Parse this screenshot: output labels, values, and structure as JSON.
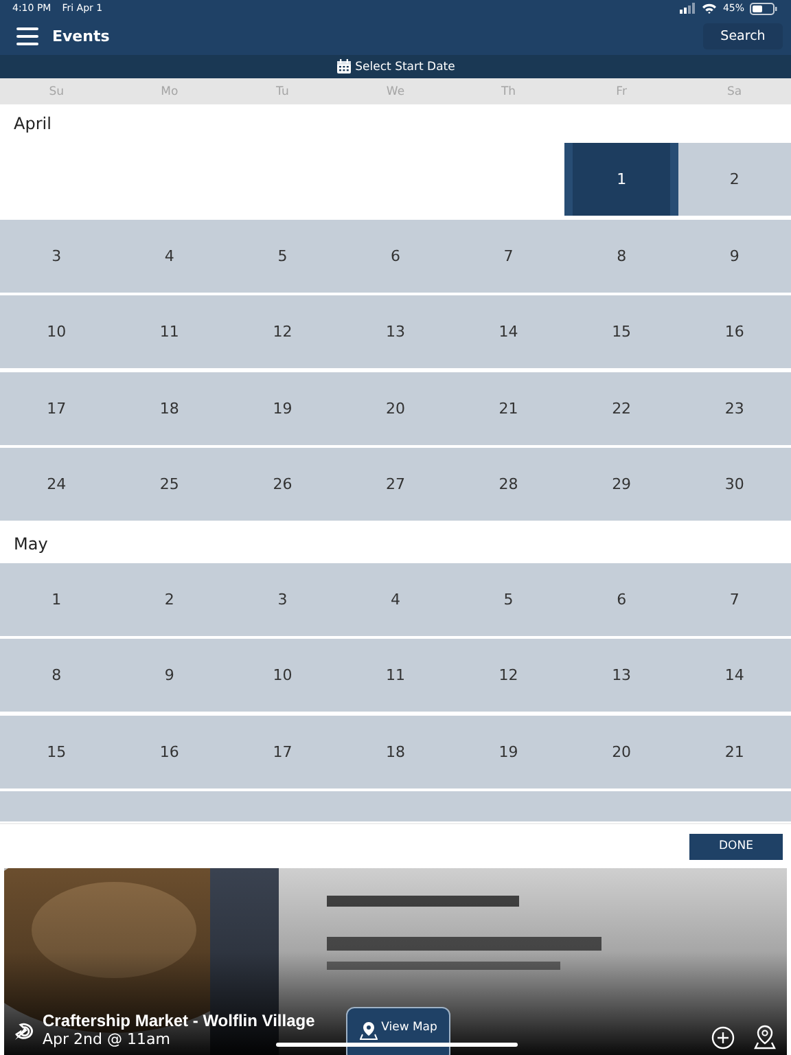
{
  "status_bar": {
    "time": "4:10 PM",
    "date": "Fri Apr 1",
    "battery": "45%"
  },
  "header": {
    "title": "Events",
    "search_button": "Search"
  },
  "date_bar": {
    "label": "Select Start Date"
  },
  "weekdays": [
    "Su",
    "Mo",
    "Tu",
    "We",
    "Th",
    "Fr",
    "Sa"
  ],
  "months": [
    {
      "name": "April",
      "weeks": [
        [
          {
            "kind": "empty"
          },
          {
            "kind": "empty"
          },
          {
            "kind": "empty"
          },
          {
            "kind": "empty"
          },
          {
            "kind": "empty"
          },
          {
            "kind": "day",
            "label": "1",
            "selected": true
          },
          {
            "kind": "day",
            "label": "2",
            "selected": false
          }
        ],
        [
          {
            "kind": "day",
            "label": "3",
            "selected": false
          },
          {
            "kind": "day",
            "label": "4",
            "selected": false
          },
          {
            "kind": "day",
            "label": "5",
            "selected": false
          },
          {
            "kind": "day",
            "label": "6",
            "selected": false
          },
          {
            "kind": "day",
            "label": "7",
            "selected": false
          },
          {
            "kind": "day",
            "label": "8",
            "selected": false
          },
          {
            "kind": "day",
            "label": "9",
            "selected": false
          }
        ],
        [
          {
            "kind": "day",
            "label": "10",
            "selected": false
          },
          {
            "kind": "day",
            "label": "11",
            "selected": false
          },
          {
            "kind": "day",
            "label": "12",
            "selected": false
          },
          {
            "kind": "day",
            "label": "13",
            "selected": false
          },
          {
            "kind": "day",
            "label": "14",
            "selected": false
          },
          {
            "kind": "day",
            "label": "15",
            "selected": false
          },
          {
            "kind": "day",
            "label": "16",
            "selected": false
          }
        ],
        [
          {
            "kind": "day",
            "label": "17",
            "selected": false
          },
          {
            "kind": "day",
            "label": "18",
            "selected": false
          },
          {
            "kind": "day",
            "label": "19",
            "selected": false
          },
          {
            "kind": "day",
            "label": "20",
            "selected": false
          },
          {
            "kind": "day",
            "label": "21",
            "selected": false
          },
          {
            "kind": "day",
            "label": "22",
            "selected": false
          },
          {
            "kind": "day",
            "label": "23",
            "selected": false
          }
        ],
        [
          {
            "kind": "day",
            "label": "24",
            "selected": false
          },
          {
            "kind": "day",
            "label": "25",
            "selected": false
          },
          {
            "kind": "day",
            "label": "26",
            "selected": false
          },
          {
            "kind": "day",
            "label": "27",
            "selected": false
          },
          {
            "kind": "day",
            "label": "28",
            "selected": false
          },
          {
            "kind": "day",
            "label": "29",
            "selected": false
          },
          {
            "kind": "day",
            "label": "30",
            "selected": false
          }
        ]
      ]
    },
    {
      "name": "May",
      "weeks": [
        [
          {
            "kind": "day",
            "label": "1",
            "selected": false
          },
          {
            "kind": "day",
            "label": "2",
            "selected": false
          },
          {
            "kind": "day",
            "label": "3",
            "selected": false
          },
          {
            "kind": "day",
            "label": "4",
            "selected": false
          },
          {
            "kind": "day",
            "label": "5",
            "selected": false
          },
          {
            "kind": "day",
            "label": "6",
            "selected": false
          },
          {
            "kind": "day",
            "label": "7",
            "selected": false
          }
        ],
        [
          {
            "kind": "day",
            "label": "8",
            "selected": false
          },
          {
            "kind": "day",
            "label": "9",
            "selected": false
          },
          {
            "kind": "day",
            "label": "10",
            "selected": false
          },
          {
            "kind": "day",
            "label": "11",
            "selected": false
          },
          {
            "kind": "day",
            "label": "12",
            "selected": false
          },
          {
            "kind": "day",
            "label": "13",
            "selected": false
          },
          {
            "kind": "day",
            "label": "14",
            "selected": false
          }
        ],
        [
          {
            "kind": "day",
            "label": "15",
            "selected": false
          },
          {
            "kind": "day",
            "label": "16",
            "selected": false
          },
          {
            "kind": "day",
            "label": "17",
            "selected": false
          },
          {
            "kind": "day",
            "label": "18",
            "selected": false
          },
          {
            "kind": "day",
            "label": "19",
            "selected": false
          },
          {
            "kind": "day",
            "label": "20",
            "selected": false
          },
          {
            "kind": "day",
            "label": "21",
            "selected": false
          }
        ]
      ]
    }
  ],
  "done_button": "DONE",
  "event": {
    "kind": "picture",
    "title": "Craftership Market - Wolflin Village",
    "time": "Apr 2nd @ 11am",
    "map_button": "View Map"
  }
}
